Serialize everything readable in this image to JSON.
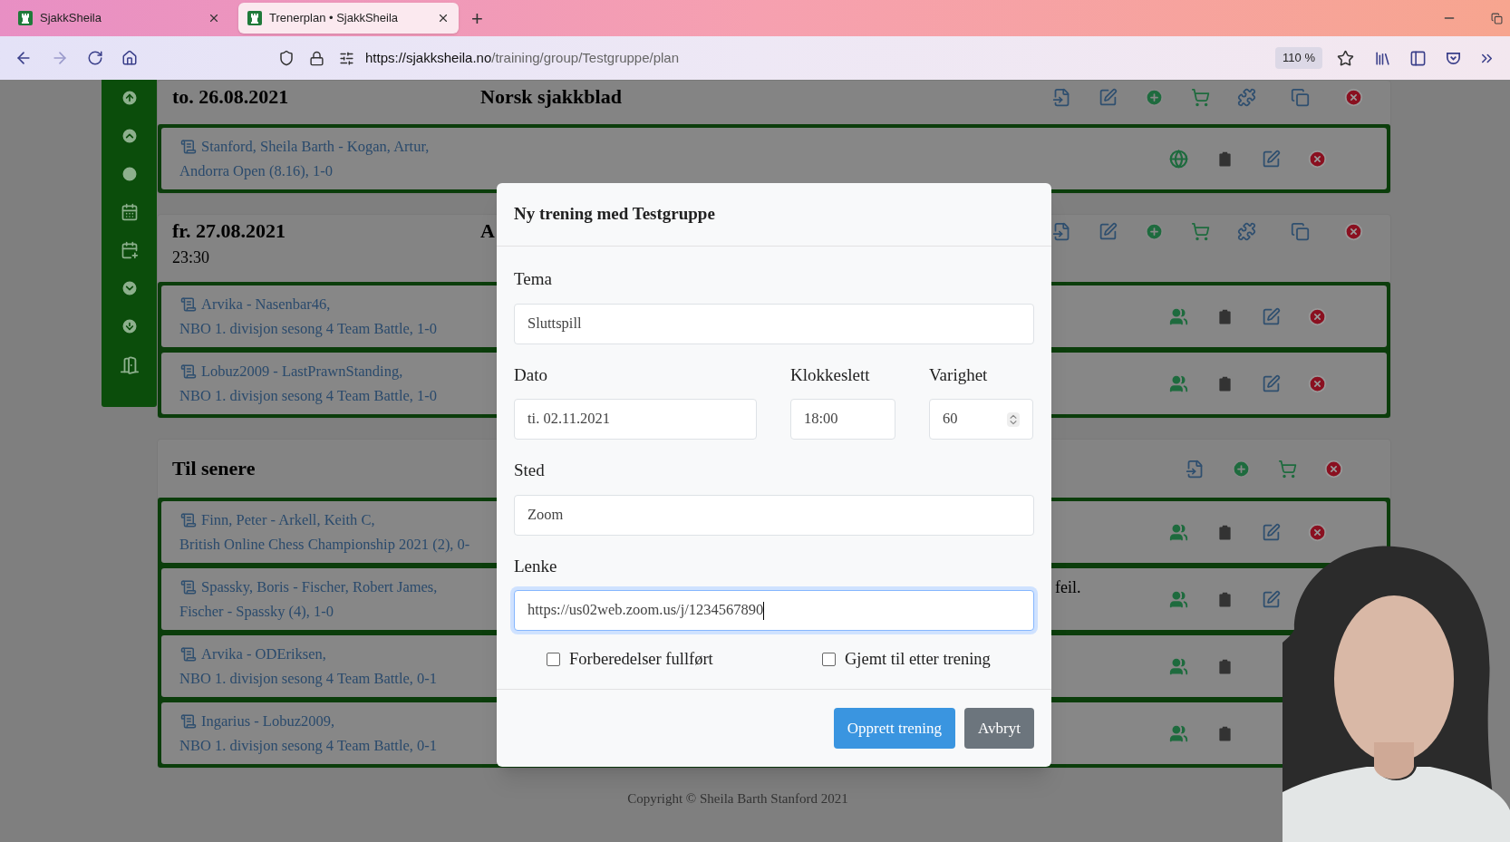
{
  "browser": {
    "tabs": [
      {
        "title": "SjakkSheila",
        "selected": false
      },
      {
        "title": "Trenerplan • SjakkSheila",
        "selected": true
      }
    ],
    "new_tab": "+",
    "url_host": "https://sjakksheila.no",
    "url_path": "/training/group/Testgruppe/plan",
    "zoom": "110 %"
  },
  "sections": [
    {
      "kind": "session",
      "date": "to. 26.08.2021",
      "title": "Norsk sjakkblad",
      "games": [
        {
          "actions": [
            {
              "kind": "public"
            },
            {
              "kind": "clipboard"
            },
            {
              "kind": "edit"
            },
            {
              "kind": "delete"
            }
          ],
          "players": "Stanford, Sheila Barth - Kogan, Artur,",
          "event": "Andorra Open (8.16), 1-0"
        }
      ]
    },
    {
      "kind": "session",
      "date": "fr. 27.08.2021",
      "time": "23:30",
      "title": "A",
      "games": [
        {
          "actions": [
            {
              "kind": "group"
            },
            {
              "kind": "clipboard"
            },
            {
              "kind": "edit"
            },
            {
              "kind": "delete"
            }
          ],
          "players": "Arvika - Nasenbar46,",
          "event": "NBO 1. divisjon sesong 4 Team Battle, 1-0"
        },
        {
          "actions": [
            {
              "kind": "group"
            },
            {
              "kind": "clipboard"
            },
            {
              "kind": "edit"
            },
            {
              "kind": "delete"
            }
          ],
          "players": "Lobuz2009 - LastPrawnStanding,",
          "event": "NBO 1. divisjon sesong 4 Team Battle, 1-0"
        }
      ]
    },
    {
      "kind": "later",
      "date": "Til senere",
      "games": [
        {
          "actions": [
            {
              "kind": "group"
            },
            {
              "kind": "clipboard"
            },
            {
              "kind": "edit"
            },
            {
              "kind": "delete"
            }
          ],
          "players": "Finn, Peter - Arkell, Keith C,",
          "event": "British Online Chess Championship 2021 (2), 0-"
        },
        {
          "actions": [
            {
              "kind": "group"
            },
            {
              "kind": "clipboard"
            },
            {
              "kind": "edit"
            }
          ],
          "players": "Spassky, Boris - Fischer, Robert James,",
          "event": "Fischer - Spassky (4), 1-0",
          "note": "feil."
        },
        {
          "actions": [
            {
              "kind": "group"
            },
            {
              "kind": "clipboard"
            }
          ],
          "players": "Arvika - ODEriksen,",
          "event": "NBO 1. divisjon sesong 4 Team Battle, 0-1"
        },
        {
          "actions": [
            {
              "kind": "group"
            },
            {
              "kind": "clipboard"
            }
          ],
          "players": "Ingarius - Lobuz2009,",
          "event": "NBO 1. divisjon sesong 4 Team Battle, 0-1"
        }
      ]
    }
  ],
  "footer": "Copyright © Sheila Barth Stanford 2021",
  "modal": {
    "title": "Ny trening med Testgruppe",
    "tema": {
      "label": "Tema",
      "value": "Sluttspill"
    },
    "dato": {
      "label": "Dato",
      "value": "ti. 02.11.2021"
    },
    "klokkeslett": {
      "label": "Klokkeslett",
      "value": "18:00"
    },
    "varighet": {
      "label": "Varighet",
      "value": "60"
    },
    "sted": {
      "label": "Sted",
      "value": "Zoom"
    },
    "lenke": {
      "label": "Lenke",
      "value": "https://us02web.zoom.us/j/1234567890",
      "focused": true
    },
    "checkboxes": [
      {
        "label": "Forberedelser fullført",
        "checked": false
      },
      {
        "label": "Gjemt til etter trening",
        "checked": false
      }
    ],
    "buttons": [
      {
        "label": "Opprett trening",
        "kind": "primary"
      },
      {
        "label": "Avbryt",
        "kind": "secondary"
      }
    ]
  }
}
